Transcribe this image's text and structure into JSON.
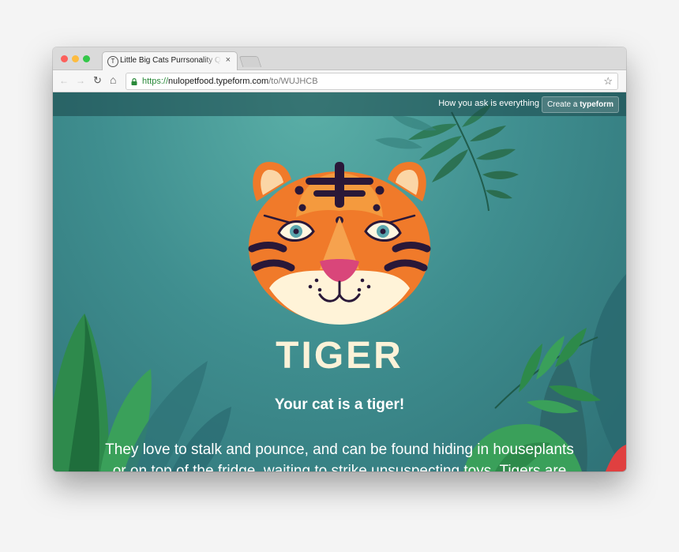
{
  "browser": {
    "tab_title": "Little Big Cats Purrsonality Quiz",
    "tab_favicon_letter": "T",
    "tab_close": "×",
    "url_scheme": "https://",
    "url_host": "nulopetfood.typeform.com",
    "url_path": "/to/WUJHCB",
    "back_icon": "←",
    "forward_icon": "→",
    "reload_icon": "↻",
    "home_icon": "⌂",
    "bookmark_icon": "☆",
    "traffic_lights": [
      "#fc605c",
      "#fdbc40",
      "#34c749"
    ]
  },
  "typeform_bar": {
    "tagline": "How you ask is everything",
    "create_prefix": "Create a",
    "create_brand": "typeform"
  },
  "result": {
    "animal": "TIGER",
    "heading": "Your cat is a tiger!",
    "description": "They love to stalk and pounce, and can be found hiding in houseplants or on top of the fridge, waiting to strike unsuspecting toys. Tigers are"
  },
  "colors": {
    "page_teal": "#3f8e8f",
    "title_cream": "#fbf2d8",
    "tiger_orange": "#f07a2a",
    "tiger_stripe": "#2a1838",
    "tiger_nose": "#d9467a"
  }
}
